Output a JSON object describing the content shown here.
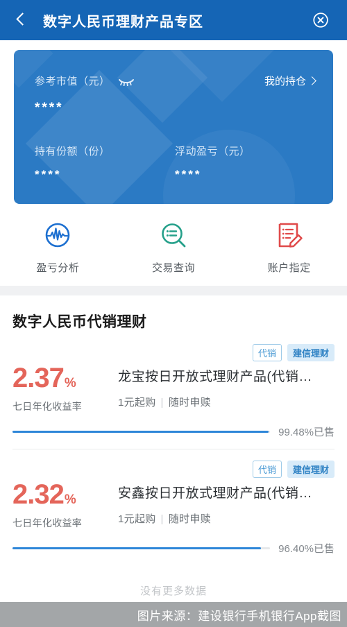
{
  "header": {
    "title": "数字人民币理财产品专区",
    "back_icon": "chevron-left-icon",
    "close_icon": "close-circle-icon",
    "bg_color": "#1565b5"
  },
  "balance_card": {
    "market_value_label": "参考市值（元）",
    "market_value_masked": "****",
    "eye_icon": "eye-closed-icon",
    "holdings_link": "我的持仓",
    "holdings_chevron": "chevron-right-icon",
    "shares_label": "持有份额（份）",
    "shares_masked": "****",
    "pnl_label": "浮动盈亏（元）",
    "pnl_masked": "****",
    "bg_color": "#2b7ac4"
  },
  "quick_actions": [
    {
      "label": "盈亏分析",
      "icon": "profit-loss-analysis-icon",
      "color": "#1c6fd0"
    },
    {
      "label": "交易查询",
      "icon": "transaction-search-icon",
      "color": "#25a08a"
    },
    {
      "label": "账户指定",
      "icon": "account-designate-icon",
      "color": "#e04a4a"
    }
  ],
  "section": {
    "title": "数字人民币代销理财"
  },
  "products": [
    {
      "tag_agency": "代销",
      "tag_issuer": "建信理财",
      "rate": "2.37",
      "rate_unit": "%",
      "rate_label": "七日年化收益率",
      "name": "龙宝按日开放式理财产品(代销…",
      "min_purchase": "1元起购",
      "redemption": "随时申赎",
      "sold_percent": 99.48,
      "sold_label": "99.48%已售"
    },
    {
      "tag_agency": "代销",
      "tag_issuer": "建信理财",
      "rate": "2.32",
      "rate_unit": "%",
      "rate_label": "七日年化收益率",
      "name": "安鑫按日开放式理财产品(代销…",
      "min_purchase": "1元起购",
      "redemption": "随时申赎",
      "sold_percent": 96.4,
      "sold_label": "96.40%已售"
    }
  ],
  "footer": {
    "no_more_data": "没有更多数据",
    "watermark": "图片来源：建设银行手机银行App截图"
  },
  "colors": {
    "accent_blue": "#1565b5",
    "rate_red": "#e4655a",
    "progress_blue": "#2e86d8",
    "tag_blue": "#2f82c4"
  }
}
